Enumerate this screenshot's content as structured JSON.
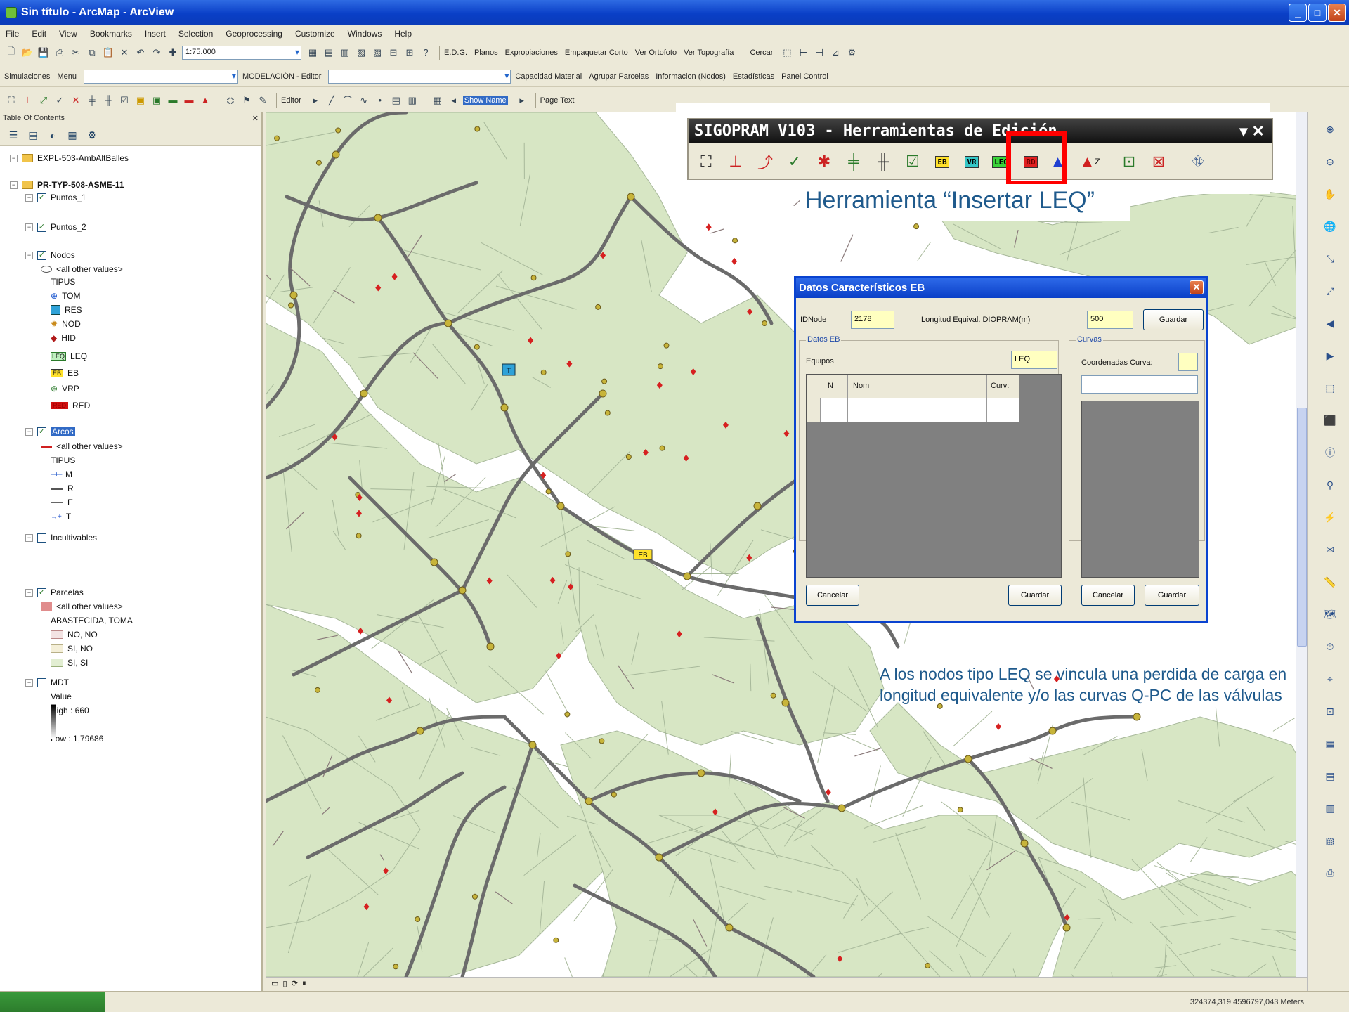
{
  "window": {
    "title": "Sin título - ArcMap - ArcView"
  },
  "menu": [
    "File",
    "Edit",
    "View",
    "Bookmarks",
    "Insert",
    "Selection",
    "Geoprocessing",
    "Customize",
    "Windows",
    "Help"
  ],
  "toolbar1": {
    "scale": "1:75.000",
    "buttons": [
      "E.D.G.",
      "Planos",
      "Expropiaciones",
      "Empaquetar Corto",
      "Ver Ortofoto",
      "Ver Topografía",
      "Cercar"
    ]
  },
  "toolbar2": {
    "simulaciones": "Simulaciones",
    "menu": "Menu",
    "modelacion": "MODELACIÓN - Editor",
    "items": [
      "Capacidad Material",
      "Agrupar Parcelas",
      "Informacion (Nodos)",
      "Estadísticas",
      "Panel Control"
    ]
  },
  "toolbar3": {
    "editor": "Editor",
    "show_name": "Show Name",
    "page_text": "Page Text"
  },
  "toc": {
    "title": "Table Of Contents",
    "layers": [
      {
        "label": "EXPL-503-AmbAltBalles",
        "level": 0,
        "kind": "group"
      },
      {
        "label": "PR-TYP-508-ASME-11",
        "level": 0,
        "kind": "group-bold"
      },
      {
        "label": "Puntos_1",
        "level": 1,
        "kind": "layer"
      },
      {
        "label": "Puntos_2",
        "level": 1,
        "kind": "layer"
      },
      {
        "label": "Nodos",
        "level": 1,
        "kind": "layer"
      },
      {
        "label": "<all other values>",
        "level": 2,
        "kind": "legend"
      },
      {
        "label": "TIPUS",
        "level": 3,
        "kind": "text"
      },
      {
        "label": "TOM",
        "level": 3,
        "kind": "legend"
      },
      {
        "label": "RES",
        "level": 3,
        "kind": "legend"
      },
      {
        "label": "NOD",
        "level": 3,
        "kind": "legend"
      },
      {
        "label": "HID",
        "level": 3,
        "kind": "legend"
      },
      {
        "label": "LEQ",
        "level": 3,
        "kind": "legend"
      },
      {
        "label": "EB",
        "level": 3,
        "kind": "legend"
      },
      {
        "label": "VRP",
        "level": 3,
        "kind": "legend"
      },
      {
        "label": "RED",
        "level": 3,
        "kind": "legend"
      },
      {
        "label": "Arcos",
        "level": 1,
        "kind": "layer-selected"
      },
      {
        "label": "<all other values>",
        "level": 2,
        "kind": "legend"
      },
      {
        "label": "TIPUS",
        "level": 3,
        "kind": "text"
      },
      {
        "label": "M",
        "level": 3,
        "kind": "legend"
      },
      {
        "label": "R",
        "level": 3,
        "kind": "legend"
      },
      {
        "label": "E",
        "level": 3,
        "kind": "legend"
      },
      {
        "label": "T",
        "level": 3,
        "kind": "legend"
      },
      {
        "label": "Incultivables",
        "level": 1,
        "kind": "layer-unchecked"
      },
      {
        "label": "Parcelas",
        "level": 1,
        "kind": "layer"
      },
      {
        "label": "<all other values>",
        "level": 2,
        "kind": "legend"
      },
      {
        "label": "ABASTECIDA, TOMA",
        "level": 3,
        "kind": "text"
      },
      {
        "label": "NO, NO",
        "level": 3,
        "kind": "legend"
      },
      {
        "label": "SI, NO",
        "level": 3,
        "kind": "legend"
      },
      {
        "label": "SI, SI",
        "level": 3,
        "kind": "legend"
      },
      {
        "label": "MDT",
        "level": 1,
        "kind": "layer-unchecked"
      },
      {
        "label": "Value",
        "level": 3,
        "kind": "text"
      },
      {
        "label": "High : 660",
        "level": 3,
        "kind": "text"
      },
      {
        "label": "Low : 1,79686",
        "level": 3,
        "kind": "text"
      }
    ]
  },
  "sigopram": {
    "title": "SIGOPRAM V103 - Herramientas de Edición",
    "controls": "▾ ✕",
    "tool_tags": {
      "eb": "EB",
      "vr": "VR",
      "leq": "LEQ",
      "rd": "RD",
      "l": "L",
      "z": "Z"
    }
  },
  "caption": "Herramienta “Insertar LEQ”",
  "dialog": {
    "title": "Datos Característicos EB",
    "idnode_label": "IDNode",
    "idnode_value": "2178",
    "longitud_label": "Longitud Equival. DIOPRAM(m)",
    "longitud_value": "500",
    "guardar_top": "Guardar",
    "datos_eb": "Datos EB",
    "equipos_label": "Equipos",
    "equipos_value": "LEQ",
    "curvas_group": "Curvas",
    "coordenadas_label": "Coordenadas Curva:",
    "col_n": "N",
    "col_nom": "Nom",
    "col_curv": "Curv:",
    "cancelar_left": "Cancelar",
    "guardar_left": "Guardar",
    "cancelar_right": "Cancelar",
    "guardar_right": "Guardar"
  },
  "note": "A los nodos tipo LEQ se vincula una perdida de carga en longitud equivalente y/o las curvas Q-PC de las válvulas",
  "map": {
    "labels": {
      "t_marker": "T",
      "eb_marker": "EB"
    }
  },
  "status": {
    "coords": "324374,319 4596797,043 Meters"
  },
  "colors": {
    "parcel_fill": "#d7e6c4",
    "parcel_stroke": "#a7b89a",
    "pipe": "#6b6b6b",
    "node": "#c7b43a",
    "hydrant": "#d62020",
    "accent": "#ff0000",
    "caption": "#1f5a8c"
  }
}
